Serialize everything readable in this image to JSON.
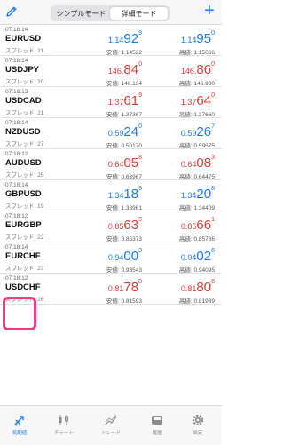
{
  "header": {
    "segment_simple": "シンプルモード",
    "segment_detail": "詳細モード",
    "plus_symbol": "+"
  },
  "colors": {
    "accent": "#1b7cf2",
    "down": "#e0403a",
    "highlight": "#ef3b7f"
  },
  "quotes": [
    {
      "time": "07:18:14",
      "symbol": "EURUSD",
      "spread": "スプレッド: 21",
      "bid": {
        "small": "1.14",
        "big": "92",
        "pip": "9",
        "dir": "up"
      },
      "ask": {
        "small": "1.14",
        "big": "95",
        "pip": "0",
        "dir": "up"
      },
      "low": "安値: 1.14522",
      "high": "高値: 1.15066"
    },
    {
      "time": "07:18:14",
      "symbol": "USDJPY",
      "spread": "スプレッド: 20",
      "bid": {
        "small": "146.",
        "big": "84",
        "pip": "0",
        "dir": "down"
      },
      "ask": {
        "small": "146.",
        "big": "86",
        "pip": "0",
        "dir": "down"
      },
      "low": "安値: 146.134",
      "high": "高値: 146.900"
    },
    {
      "time": "07:18:13",
      "symbol": "USDCAD",
      "spread": "スプレッド: 21",
      "bid": {
        "small": "1.37",
        "big": "61",
        "pip": "9",
        "dir": "down"
      },
      "ask": {
        "small": "1.37",
        "big": "64",
        "pip": "0",
        "dir": "down"
      },
      "low": "安値: 1.37367",
      "high": "高値: 1.37660"
    },
    {
      "time": "07:18:14",
      "symbol": "NZDUSD",
      "spread": "スプレッド: 27",
      "bid": {
        "small": "0.59",
        "big": "24",
        "pip": "0",
        "dir": "up"
      },
      "ask": {
        "small": "0.59",
        "big": "26",
        "pip": "7",
        "dir": "up"
      },
      "low": "安値: 0.59170",
      "high": "高値: 0.59575"
    },
    {
      "time": "07:18:12",
      "symbol": "AUDUSD",
      "spread": "スプレッド: 25",
      "bid": {
        "small": "0.64",
        "big": "05",
        "pip": "8",
        "dir": "down"
      },
      "ask": {
        "small": "0.64",
        "big": "08",
        "pip": "3",
        "dir": "down"
      },
      "low": "安値: 0.63967",
      "high": "高値: 0.64475"
    },
    {
      "time": "07:18:14",
      "symbol": "GBPUSD",
      "spread": "スプレッド: 19",
      "bid": {
        "small": "1.34",
        "big": "18",
        "pip": "9",
        "dir": "up"
      },
      "ask": {
        "small": "1.34",
        "big": "20",
        "pip": "8",
        "dir": "up"
      },
      "low": "安値: 1.33961",
      "high": "高値: 1.34409"
    },
    {
      "time": "07:18:12",
      "symbol": "EURGBP",
      "spread": "スプレッド: 22",
      "bid": {
        "small": "0.85",
        "big": "63",
        "pip": "9",
        "dir": "down"
      },
      "ask": {
        "small": "0.85",
        "big": "66",
        "pip": "1",
        "dir": "down"
      },
      "low": "安値: 0.85373",
      "high": "高値: 0.85766"
    },
    {
      "time": "07:18:14",
      "symbol": "EURCHF",
      "spread": "スプレッド: 23",
      "bid": {
        "small": "0.94",
        "big": "00",
        "pip": "3",
        "dir": "up"
      },
      "ask": {
        "small": "0.94",
        "big": "02",
        "pip": "6",
        "dir": "up"
      },
      "low": "安値: 0.93543",
      "high": "高値: 0.94095"
    },
    {
      "time": "07:18:12",
      "symbol": "USDCHF",
      "spread": "スプレッド: 26",
      "bid": {
        "small": "0.81",
        "big": "78",
        "pip": "0",
        "dir": "down"
      },
      "ask": {
        "small": "0.81",
        "big": "80",
        "pip": "6",
        "dir": "down"
      },
      "low": "安値: 0.81593",
      "high": "高値: 0.81939"
    }
  ],
  "tabs": [
    {
      "label": "気配値",
      "icon": "quotes-arrows-icon",
      "active": true
    },
    {
      "label": "チャート",
      "icon": "candlestick-chart-icon",
      "active": false
    },
    {
      "label": "トレード",
      "icon": "trade-chart-icon",
      "active": false
    },
    {
      "label": "履歴",
      "icon": "history-tray-icon",
      "active": false
    },
    {
      "label": "設定",
      "icon": "settings-gear-icon",
      "active": false
    }
  ]
}
